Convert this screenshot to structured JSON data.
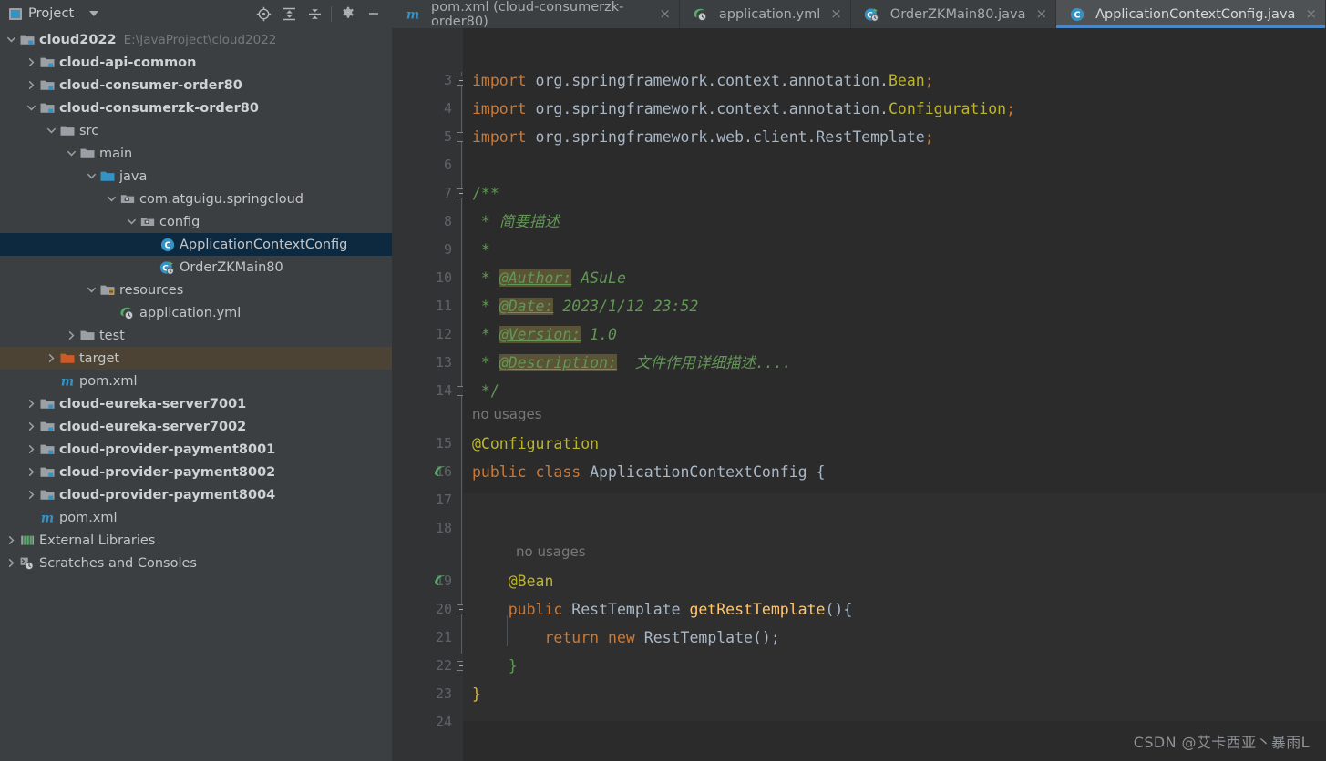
{
  "project_panel": {
    "title": "Project",
    "title_icon": "project-window-icon",
    "dropdown_icon": "chevron-down-icon",
    "tools": [
      {
        "name": "locate-in-tree-icon",
        "label": "Select Opened File"
      },
      {
        "name": "expand-all-icon",
        "label": "Expand All"
      },
      {
        "name": "collapse-all-icon",
        "label": "Collapse All"
      },
      {
        "name": "gear-icon",
        "label": "Options"
      },
      {
        "name": "minimize-icon",
        "label": "Hide"
      }
    ],
    "tree": [
      {
        "label": "cloud2022",
        "secondary": "E:\\JavaProject\\cloud2022",
        "icon": "module-folder-icon",
        "arrow": "expanded",
        "depth": 0,
        "bold": true,
        "state": "normal"
      },
      {
        "label": "cloud-api-common",
        "secondary": "",
        "icon": "module-folder-icon",
        "arrow": "collapsed",
        "depth": 1,
        "bold": true,
        "state": "normal"
      },
      {
        "label": "cloud-consumer-order80",
        "secondary": "",
        "icon": "module-folder-icon",
        "arrow": "collapsed",
        "depth": 1,
        "bold": true,
        "state": "normal"
      },
      {
        "label": "cloud-consumerzk-order80",
        "secondary": "",
        "icon": "module-folder-icon",
        "arrow": "expanded",
        "depth": 1,
        "bold": true,
        "state": "normal"
      },
      {
        "label": "src",
        "secondary": "",
        "icon": "folder-icon",
        "arrow": "expanded",
        "depth": 2,
        "bold": false,
        "state": "normal"
      },
      {
        "label": "main",
        "secondary": "",
        "icon": "folder-icon",
        "arrow": "expanded",
        "depth": 3,
        "bold": false,
        "state": "normal"
      },
      {
        "label": "java",
        "secondary": "",
        "icon": "source-root-folder-icon",
        "arrow": "expanded",
        "depth": 4,
        "bold": false,
        "state": "normal"
      },
      {
        "label": "com.atguigu.springcloud",
        "secondary": "",
        "icon": "package-icon",
        "arrow": "expanded",
        "depth": 5,
        "bold": false,
        "state": "normal"
      },
      {
        "label": "config",
        "secondary": "",
        "icon": "package-icon",
        "arrow": "expanded",
        "depth": 6,
        "bold": false,
        "state": "normal"
      },
      {
        "label": "ApplicationContextConfig",
        "secondary": "",
        "icon": "java-class-icon",
        "arrow": "none",
        "depth": 7,
        "bold": false,
        "state": "selected"
      },
      {
        "label": "OrderZKMain80",
        "secondary": "",
        "icon": "java-runnable-class-icon",
        "arrow": "none",
        "depth": 7,
        "bold": false,
        "state": "normal"
      },
      {
        "label": "resources",
        "secondary": "",
        "icon": "resources-folder-icon",
        "arrow": "expanded",
        "depth": 4,
        "bold": false,
        "state": "normal"
      },
      {
        "label": "application.yml",
        "secondary": "",
        "icon": "spring-yaml-icon",
        "arrow": "none",
        "depth": 5,
        "bold": false,
        "state": "normal"
      },
      {
        "label": "test",
        "secondary": "",
        "icon": "folder-icon",
        "arrow": "collapsed",
        "depth": 3,
        "bold": false,
        "state": "normal"
      },
      {
        "label": "target",
        "secondary": "",
        "icon": "excluded-folder-icon",
        "arrow": "collapsed",
        "depth": 2,
        "bold": false,
        "state": "highlighted"
      },
      {
        "label": "pom.xml",
        "secondary": "",
        "icon": "maven-icon",
        "arrow": "none",
        "depth": 2,
        "bold": false,
        "state": "normal"
      },
      {
        "label": "cloud-eureka-server7001",
        "secondary": "",
        "icon": "module-folder-icon",
        "arrow": "collapsed",
        "depth": 1,
        "bold": true,
        "state": "normal"
      },
      {
        "label": "cloud-eureka-server7002",
        "secondary": "",
        "icon": "module-folder-icon",
        "arrow": "collapsed",
        "depth": 1,
        "bold": true,
        "state": "normal"
      },
      {
        "label": "cloud-provider-payment8001",
        "secondary": "",
        "icon": "module-folder-icon",
        "arrow": "collapsed",
        "depth": 1,
        "bold": true,
        "state": "normal"
      },
      {
        "label": "cloud-provider-payment8002",
        "secondary": "",
        "icon": "module-folder-icon",
        "arrow": "collapsed",
        "depth": 1,
        "bold": true,
        "state": "normal"
      },
      {
        "label": "cloud-provider-payment8004",
        "secondary": "",
        "icon": "module-folder-icon",
        "arrow": "collapsed",
        "depth": 1,
        "bold": true,
        "state": "normal"
      },
      {
        "label": "pom.xml",
        "secondary": "",
        "icon": "maven-icon",
        "arrow": "none",
        "depth": 1,
        "bold": false,
        "state": "normal"
      },
      {
        "label": "External Libraries",
        "secondary": "",
        "icon": "external-libraries-icon",
        "arrow": "collapsed",
        "depth": 0,
        "bold": false,
        "state": "normal"
      },
      {
        "label": "Scratches and Consoles",
        "secondary": "",
        "icon": "scratches-icon",
        "arrow": "collapsed",
        "depth": 0,
        "bold": false,
        "state": "normal"
      }
    ]
  },
  "editor": {
    "tabs": [
      {
        "label": "pom.xml (cloud-consumerzk-order80)",
        "icon": "maven-icon",
        "active": false,
        "close_icon": "close-icon"
      },
      {
        "label": "application.yml",
        "icon": "spring-yaml-icon",
        "active": false,
        "close_icon": "close-icon"
      },
      {
        "label": "OrderZKMain80.java",
        "icon": "java-runnable-class-icon",
        "active": false,
        "close_icon": "close-icon"
      },
      {
        "label": "ApplicationContextConfig.java",
        "icon": "java-class-icon",
        "active": true,
        "close_icon": "close-icon"
      }
    ],
    "first_line_number": 3,
    "line_numbers": [
      3,
      4,
      5,
      6,
      7,
      8,
      9,
      10,
      11,
      12,
      13,
      14,
      15,
      16,
      17,
      18,
      19,
      20,
      21,
      22,
      23,
      24
    ],
    "gutter_icons": [
      {
        "line": 16,
        "name": "spring-bean-gutter-icon"
      },
      {
        "line": 19,
        "name": "spring-bean-navigate-gutter-icon"
      }
    ],
    "inlay_hints": [
      {
        "text": "no usages",
        "before_line": 15
      },
      {
        "text": "no usages",
        "before_line": 19
      }
    ],
    "code_lines": [
      {
        "n": 3,
        "tokens": [
          {
            "t": "import ",
            "c": "k"
          },
          {
            "t": "org.springframework.context.annotation.",
            "c": "plain"
          },
          {
            "t": "Bean",
            "c": "anno"
          },
          {
            "t": ";",
            "c": "k"
          }
        ]
      },
      {
        "n": 4,
        "tokens": [
          {
            "t": "import ",
            "c": "k"
          },
          {
            "t": "org.springframework.context.annotation.",
            "c": "plain"
          },
          {
            "t": "Configuration",
            "c": "anno"
          },
          {
            "t": ";",
            "c": "k"
          }
        ]
      },
      {
        "n": 5,
        "tokens": [
          {
            "t": "import ",
            "c": "k"
          },
          {
            "t": "org.springframework.web.client.",
            "c": "plain"
          },
          {
            "t": "RestTemplate",
            "c": "plain"
          },
          {
            "t": ";",
            "c": "k"
          }
        ]
      },
      {
        "n": 6,
        "tokens": []
      },
      {
        "n": 7,
        "tokens": [
          {
            "t": "/**",
            "c": "cmt-plain"
          }
        ]
      },
      {
        "n": 8,
        "tokens": [
          {
            "t": " * ",
            "c": "cmt-plain"
          },
          {
            "t": "简要描述",
            "c": "cmt"
          }
        ]
      },
      {
        "n": 9,
        "tokens": [
          {
            "t": " *",
            "c": "cmt-plain"
          }
        ]
      },
      {
        "n": 10,
        "tokens": [
          {
            "t": " * ",
            "c": "cmt-plain"
          },
          {
            "t": "@Author:",
            "c": "tag"
          },
          {
            "t": " ASuLe",
            "c": "cmt"
          }
        ]
      },
      {
        "n": 11,
        "tokens": [
          {
            "t": " * ",
            "c": "cmt-plain"
          },
          {
            "t": "@Date:",
            "c": "tag"
          },
          {
            "t": " 2023/1/12 23:52",
            "c": "cmt"
          }
        ]
      },
      {
        "n": 12,
        "tokens": [
          {
            "t": " * ",
            "c": "cmt-plain"
          },
          {
            "t": "@Version:",
            "c": "tag"
          },
          {
            "t": " 1.0",
            "c": "cmt"
          }
        ]
      },
      {
        "n": 13,
        "tokens": [
          {
            "t": " * ",
            "c": "cmt-plain"
          },
          {
            "t": "@Description:",
            "c": "tag"
          },
          {
            "t": "  文件作用详细描述....",
            "c": "cmt"
          }
        ]
      },
      {
        "n": 14,
        "tokens": [
          {
            "t": " */",
            "c": "cmt-plain"
          }
        ]
      },
      {
        "n": 15,
        "tokens": [
          {
            "t": "@Configuration",
            "c": "anno"
          }
        ]
      },
      {
        "n": 16,
        "tokens": [
          {
            "t": "public ",
            "c": "k"
          },
          {
            "t": "class ",
            "c": "k"
          },
          {
            "t": "ApplicationContextConfig ",
            "c": "plain"
          },
          {
            "t": "{",
            "c": "plain"
          }
        ]
      },
      {
        "n": 17,
        "tokens": []
      },
      {
        "n": 18,
        "tokens": []
      },
      {
        "n": 19,
        "tokens": [
          {
            "t": "    @Bean",
            "c": "anno"
          }
        ]
      },
      {
        "n": 20,
        "tokens": [
          {
            "t": "    ",
            "c": "plain"
          },
          {
            "t": "public ",
            "c": "k"
          },
          {
            "t": "RestTemplate ",
            "c": "plain"
          },
          {
            "t": "getRestTemplate",
            "c": "meth"
          },
          {
            "t": "(){",
            "c": "plain"
          }
        ]
      },
      {
        "n": 21,
        "tokens": [
          {
            "t": "        ",
            "c": "plain"
          },
          {
            "t": "return ",
            "c": "k"
          },
          {
            "t": "new ",
            "c": "k"
          },
          {
            "t": "RestTemplate",
            "c": "plain"
          },
          {
            "t": "();",
            "c": "plain"
          }
        ]
      },
      {
        "n": 22,
        "tokens": [
          {
            "t": "    ",
            "c": "plain"
          },
          {
            "t": "}",
            "c": "brace-g"
          }
        ]
      },
      {
        "n": 23,
        "tokens": [
          {
            "t": "}",
            "c": "brace-y"
          }
        ]
      },
      {
        "n": 24,
        "tokens": []
      }
    ]
  },
  "watermark": "CSDN @艾卡西亚丶暴雨L",
  "colors": {
    "panel_bg": "#3c3f41",
    "editor_bg": "#2b2b2b",
    "gutter_bg": "#313335",
    "selection_bg": "#0d293f",
    "excluded_row_bg": "#4c4334",
    "tab_active_bg": "#4e5254",
    "tab_active_underline": "#4a88c7",
    "keyword": "#cc7832",
    "annotation": "#bbb529",
    "method": "#ffc66d",
    "identifier": "#a9b7c6",
    "comment": "#629755",
    "javadoc_tag_bg": "#5b5335"
  }
}
